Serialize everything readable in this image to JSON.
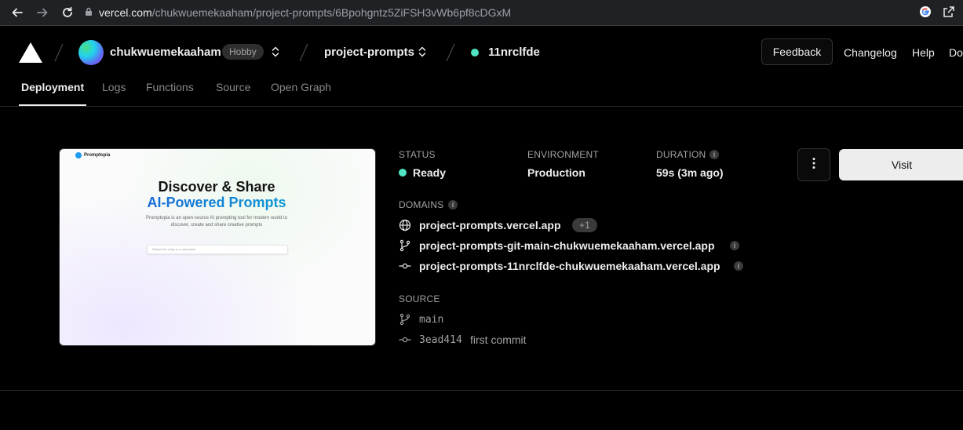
{
  "browser": {
    "url_host": "vercel.com",
    "url_path": "/chukwuemekaaham/project-prompts/6Bpohgntz5ZiFSH3vWb6pf8cDGxM"
  },
  "header": {
    "team_name": "chukwuemekaaham",
    "plan_badge": "Hobby",
    "project_name": "project-prompts",
    "deployment_id": "11nrclfde",
    "feedback_label": "Feedback",
    "changelog_label": "Changelog",
    "help_label": "Help",
    "docs_label": "Do"
  },
  "tabs": [
    {
      "label": "Deployment",
      "active": true
    },
    {
      "label": "Logs",
      "active": false
    },
    {
      "label": "Functions",
      "active": false
    },
    {
      "label": "Source",
      "active": false
    },
    {
      "label": "Open Graph",
      "active": false
    }
  ],
  "preview": {
    "brand": "Promptopia",
    "heading_line1": "Discover & Share",
    "heading_line2": "AI-Powered Prompts",
    "description": "Promptopia is an open-source AI prompting tool for modern world to discover, create and share creative prompts",
    "search_placeholder": "Search for a tag or a username"
  },
  "details": {
    "status_label": "STATUS",
    "status_value": "Ready",
    "environment_label": "ENVIRONMENT",
    "environment_value": "Production",
    "duration_label": "DURATION",
    "duration_value": "59s (3m ago)",
    "domains_label": "DOMAINS",
    "domains": [
      {
        "name": "project-prompts.vercel.app",
        "extra": "+1"
      },
      {
        "name": "project-prompts-git-main-chukwuemekaaham.vercel.app"
      },
      {
        "name": "project-prompts-11nrclfde-chukwuemekaaham.vercel.app"
      }
    ],
    "source_label": "SOURCE",
    "branch": "main",
    "commit_sha": "3ead414",
    "commit_message": "first commit"
  },
  "actions": {
    "visit_label": "Visit"
  },
  "colors": {
    "background": "#000000",
    "ready_green": "#50e3c2",
    "text_primary": "#ededed",
    "text_muted": "#a1a1a1"
  },
  "icons": [
    "back-arrow-icon",
    "forward-arrow-icon",
    "reload-icon",
    "lock-icon",
    "google-icon",
    "share-icon",
    "vercel-logo-icon",
    "chevron-updown-icon",
    "info-icon",
    "globe-icon",
    "git-branch-icon",
    "git-commit-icon",
    "kebab-menu-icon"
  ]
}
